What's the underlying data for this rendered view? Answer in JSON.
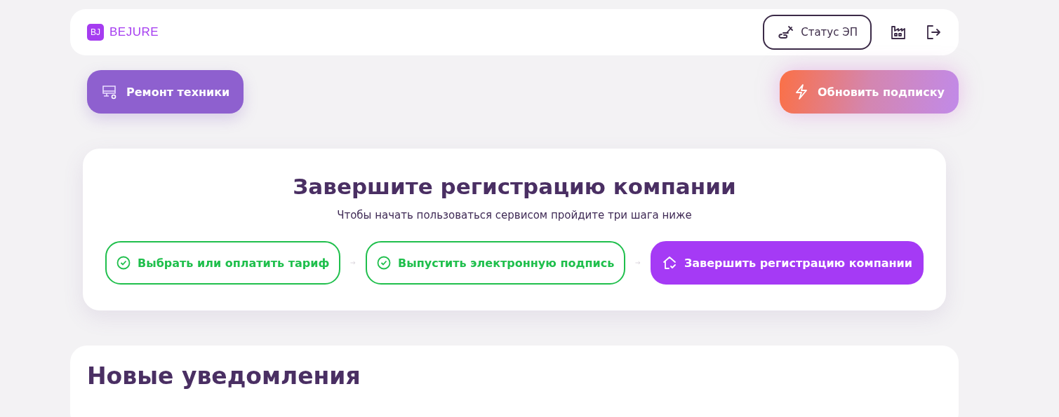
{
  "header": {
    "logo_mark": "BJ",
    "logo_text": "BEJURE",
    "status_button": "Статус ЭП"
  },
  "actions": {
    "repair_button": "Ремонт техники",
    "subscription_button": "Обновить подписку"
  },
  "registration": {
    "title": "Завершите регистрацию компании",
    "subtitle": "Чтобы начать пользоваться сервисом пройдите три шага ниже",
    "steps": [
      {
        "label": "Выбрать или оплатить тариф",
        "done": true
      },
      {
        "label": "Выпустить электронную подпись",
        "done": true
      },
      {
        "label": "Завершить регистрацию компании",
        "done": false
      }
    ]
  },
  "notifications": {
    "title": "Новые уведомления"
  }
}
